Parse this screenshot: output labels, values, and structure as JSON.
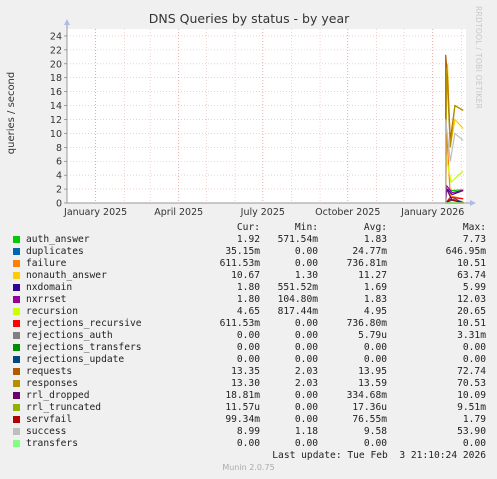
{
  "chart_data": {
    "type": "line",
    "title": "DNS Queries by status - by year",
    "ylabel": "queries / second",
    "xlabel": "",
    "ylim": [
      0,
      25
    ],
    "y_ticks": [
      0,
      2,
      4,
      6,
      8,
      10,
      12,
      14,
      16,
      18,
      20,
      22,
      24
    ],
    "x_ticks": [
      "January 2025",
      "April 2025",
      "July 2025",
      "October 2025",
      "January 2026"
    ],
    "xlim": [
      "2024-12-01",
      "2026-02-06"
    ],
    "grid": true,
    "side_label": "RRDTOOL / TOBI OETIKER",
    "columns": {
      "cur": "Cur:",
      "min": "Min:",
      "avg": "Avg:",
      "max": "Max:"
    },
    "series": [
      {
        "name": "auth_answer",
        "color": "#00cc00",
        "cur": "1.92",
        "min": "571.54m",
        "avg": "1.83",
        "max": "7.73",
        "points": [
          [
            "2026-01-15",
            0
          ],
          [
            "2026-01-15",
            2.0
          ],
          [
            "2026-01-22",
            1.8
          ],
          [
            "2026-02-03",
            1.9
          ]
        ]
      },
      {
        "name": "duplicates",
        "color": "#0066b3",
        "cur": "35.15m",
        "min": "0.00",
        "avg": "24.77m",
        "max": "646.95m",
        "points": [
          [
            "2026-01-15",
            0
          ],
          [
            "2026-01-25",
            0.6
          ],
          [
            "2026-02-03",
            0.04
          ]
        ]
      },
      {
        "name": "failure",
        "color": "#ff8000",
        "cur": "611.53m",
        "min": "0.00",
        "avg": "736.81m",
        "max": "10.51",
        "points": [
          [
            "2026-01-15",
            0
          ],
          [
            "2026-01-16",
            10.5
          ],
          [
            "2026-01-20",
            1.0
          ],
          [
            "2026-02-03",
            0.6
          ]
        ]
      },
      {
        "name": "nonauth_answer",
        "color": "#ffcc00",
        "cur": "10.67",
        "min": "1.30",
        "avg": "11.27",
        "max": "63.74",
        "points": [
          [
            "2026-01-15",
            0
          ],
          [
            "2026-01-15",
            14
          ],
          [
            "2026-01-17",
            20
          ],
          [
            "2026-01-20",
            8
          ],
          [
            "2026-01-25",
            12
          ],
          [
            "2026-02-03",
            10.7
          ]
        ]
      },
      {
        "name": "nxdomain",
        "color": "#330099",
        "cur": "1.80",
        "min": "551.52m",
        "avg": "1.69",
        "max": "5.99",
        "points": [
          [
            "2026-01-15",
            0
          ],
          [
            "2026-01-15",
            2.2
          ],
          [
            "2026-01-22",
            1.2
          ],
          [
            "2026-02-03",
            1.8
          ]
        ]
      },
      {
        "name": "nxrrset",
        "color": "#990099",
        "cur": "1.80",
        "min": "104.80m",
        "avg": "1.83",
        "max": "12.03",
        "points": [
          [
            "2026-01-15",
            0
          ],
          [
            "2026-01-16",
            2.5
          ],
          [
            "2026-01-22",
            1.5
          ],
          [
            "2026-02-03",
            1.8
          ]
        ]
      },
      {
        "name": "recursion",
        "color": "#ccff00",
        "cur": "4.65",
        "min": "817.44m",
        "avg": "4.95",
        "max": "20.65",
        "points": [
          [
            "2026-01-15",
            0
          ],
          [
            "2026-01-15",
            7
          ],
          [
            "2026-01-21",
            3
          ],
          [
            "2026-02-03",
            4.6
          ]
        ]
      },
      {
        "name": "rejections_recursive",
        "color": "#ff0000",
        "cur": "611.53m",
        "min": "0.00",
        "avg": "736.80m",
        "max": "10.51",
        "points": [
          [
            "2026-01-15",
            0
          ],
          [
            "2026-01-20",
            0.8
          ],
          [
            "2026-02-03",
            0.6
          ]
        ]
      },
      {
        "name": "rejections_auth",
        "color": "#808080",
        "cur": "0.00",
        "min": "0.00",
        "avg": "5.79u",
        "max": "3.31m",
        "points": [
          [
            "2026-01-15",
            0
          ],
          [
            "2026-02-03",
            0
          ]
        ]
      },
      {
        "name": "rejections_transfers",
        "color": "#008f00",
        "cur": "0.00",
        "min": "0.00",
        "avg": "0.00",
        "max": "0.00",
        "points": [
          [
            "2026-01-15",
            0
          ],
          [
            "2026-02-03",
            0
          ]
        ]
      },
      {
        "name": "rejections_update",
        "color": "#00487d",
        "cur": "0.00",
        "min": "0.00",
        "avg": "0.00",
        "max": "0.00",
        "points": [
          [
            "2026-01-15",
            0
          ],
          [
            "2026-02-03",
            0
          ]
        ]
      },
      {
        "name": "requests",
        "color": "#b35a00",
        "cur": "13.35",
        "min": "2.03",
        "avg": "13.95",
        "max": "72.74",
        "points": [
          [
            "2026-01-15",
            0
          ],
          [
            "2026-01-15",
            21.3
          ],
          [
            "2026-01-17",
            18
          ],
          [
            "2026-01-20",
            9
          ],
          [
            "2026-01-25",
            14
          ],
          [
            "2026-02-03",
            13.3
          ]
        ]
      },
      {
        "name": "responses",
        "color": "#b38f00",
        "cur": "13.30",
        "min": "2.03",
        "avg": "13.59",
        "max": "70.53",
        "points": [
          [
            "2026-01-15",
            0
          ],
          [
            "2026-01-16",
            19.5
          ],
          [
            "2026-01-20",
            8
          ],
          [
            "2026-01-25",
            14
          ],
          [
            "2026-02-03",
            13.3
          ]
        ]
      },
      {
        "name": "rrl_dropped",
        "color": "#6b006b",
        "cur": "18.81m",
        "min": "0.00",
        "avg": "334.68m",
        "max": "10.09",
        "points": [
          [
            "2026-01-15",
            0
          ],
          [
            "2026-01-16",
            2.0
          ],
          [
            "2026-01-22",
            0.4
          ],
          [
            "2026-02-03",
            0.02
          ]
        ]
      },
      {
        "name": "rrl_truncated",
        "color": "#8fb300",
        "cur": "11.57u",
        "min": "0.00",
        "avg": "17.36u",
        "max": "9.51m",
        "points": [
          [
            "2026-01-15",
            0
          ],
          [
            "2026-02-03",
            0
          ]
        ]
      },
      {
        "name": "servfail",
        "color": "#b30000",
        "cur": "99.34m",
        "min": "0.00",
        "avg": "76.55m",
        "max": "1.79",
        "points": [
          [
            "2026-01-15",
            0
          ],
          [
            "2026-01-20",
            0.5
          ],
          [
            "2026-02-03",
            0.1
          ]
        ]
      },
      {
        "name": "success",
        "color": "#bebebe",
        "cur": "8.99",
        "min": "1.18",
        "avg": "9.58",
        "max": "53.90",
        "points": [
          [
            "2026-01-15",
            0
          ],
          [
            "2026-01-15",
            12
          ],
          [
            "2026-01-20",
            6
          ],
          [
            "2026-01-25",
            10
          ],
          [
            "2026-02-03",
            9
          ]
        ]
      },
      {
        "name": "transfers",
        "color": "#80ff80",
        "cur": "0.00",
        "min": "0.00",
        "avg": "0.00",
        "max": "0.00",
        "points": [
          [
            "2026-01-15",
            0
          ],
          [
            "2026-02-03",
            0
          ]
        ]
      }
    ],
    "last_update": "Last update: Tue Feb  3 21:10:24 2026",
    "footer": "Munin 2.0.75"
  }
}
